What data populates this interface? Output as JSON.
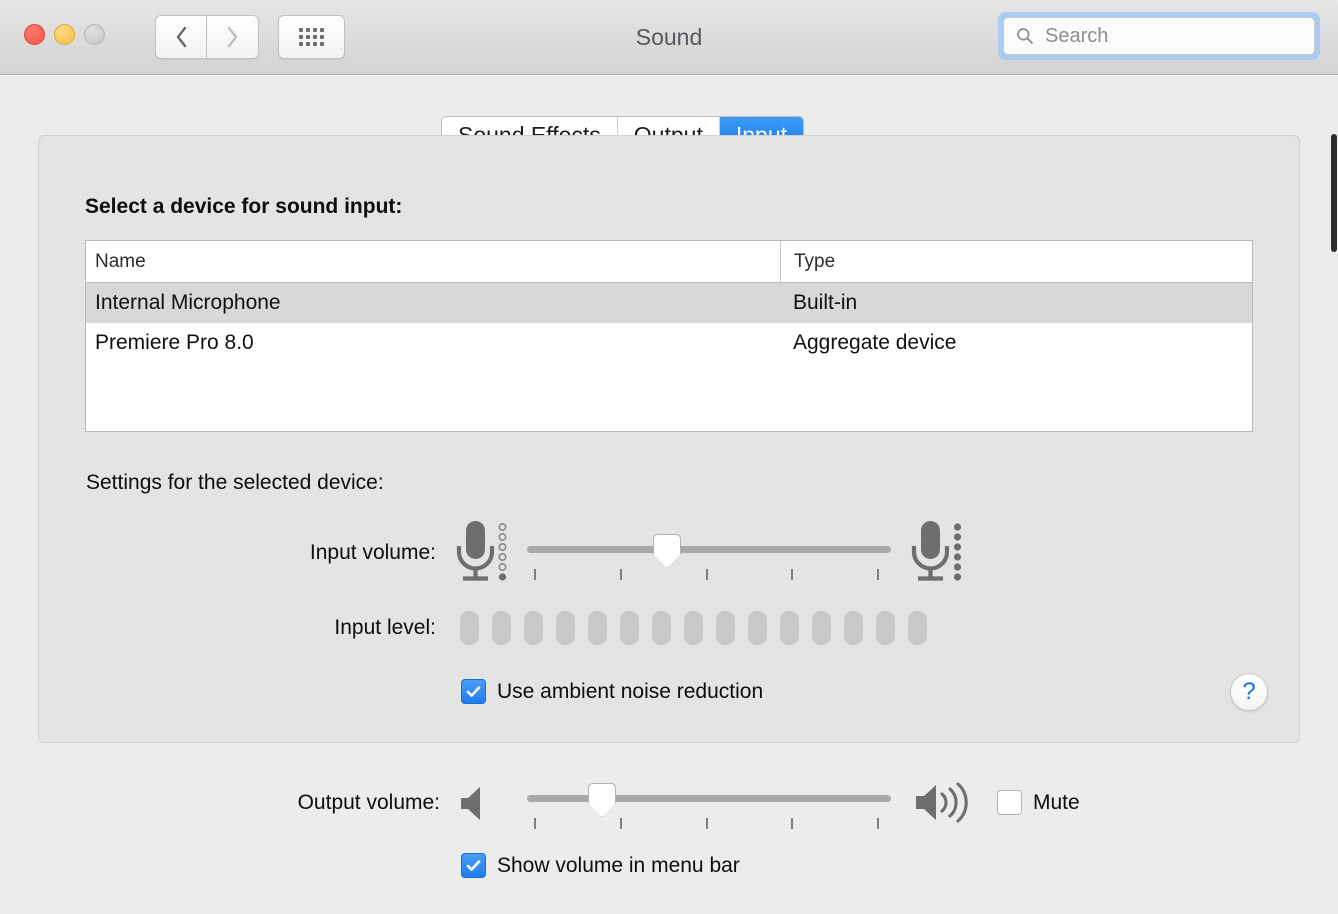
{
  "window": {
    "title": "Sound",
    "controls": {
      "close": "close-button",
      "minimize": "minimize-button",
      "zoom": "zoom-button"
    },
    "nav": {
      "back": "back-button",
      "forward": "forward-button",
      "show_all": "show-all-button"
    }
  },
  "search": {
    "placeholder": "Search",
    "value": ""
  },
  "tabs": [
    {
      "label": "Sound Effects",
      "active": false
    },
    {
      "label": "Output",
      "active": false
    },
    {
      "label": "Input",
      "active": true
    }
  ],
  "input_pane": {
    "device_heading": "Select a device for sound input:",
    "table": {
      "columns": [
        "Name",
        "Type"
      ],
      "rows": [
        {
          "name": "Internal Microphone",
          "type": "Built-in",
          "selected": true
        },
        {
          "name": "Premiere Pro 8.0",
          "type": "Aggregate device",
          "selected": false
        }
      ]
    },
    "settings_heading": "Settings for the selected device:",
    "input_volume": {
      "label": "Input volume:",
      "value_percent": 38,
      "ticks": 6,
      "min_icon": "microphone-low-icon",
      "max_icon": "microphone-high-icon"
    },
    "input_level": {
      "label": "Input level:",
      "segments": 15,
      "active_segments": 0
    },
    "noise_reduction": {
      "label": "Use ambient noise reduction",
      "checked": true
    },
    "help": {
      "label": "?",
      "name": "help-button"
    }
  },
  "output_section": {
    "output_volume": {
      "label": "Output volume:",
      "value_percent": 20,
      "ticks": 6,
      "min_icon": "speaker-low-icon",
      "max_icon": "speaker-high-icon"
    },
    "mute": {
      "label": "Mute",
      "checked": false
    },
    "show_in_menu_bar": {
      "label": "Show volume in menu bar",
      "checked": true
    }
  },
  "colors": {
    "accent": "#1d7ced",
    "window_bg": "#ececec",
    "panel_bg": "#e4e4e4",
    "selected_row": "#d8d8d8"
  }
}
